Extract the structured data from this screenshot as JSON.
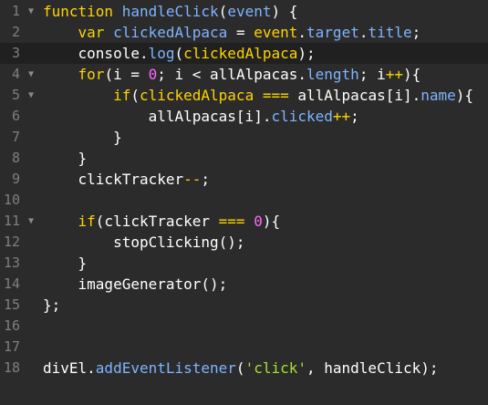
{
  "editor": {
    "lines": [
      {
        "num": "1",
        "fold": true,
        "tokens": [
          {
            "t": "function",
            "c": "kw"
          },
          {
            "t": " ",
            "c": "plain"
          },
          {
            "t": "handleClick",
            "c": "fn"
          },
          {
            "t": "(",
            "c": "plain"
          },
          {
            "t": "event",
            "c": "fn"
          },
          {
            "t": ") {",
            "c": "plain"
          }
        ]
      },
      {
        "num": "2",
        "fold": false,
        "tokens": [
          {
            "t": "    ",
            "c": "plain"
          },
          {
            "t": "var",
            "c": "kw"
          },
          {
            "t": " ",
            "c": "plain"
          },
          {
            "t": "clickedAlpaca",
            "c": "fn"
          },
          {
            "t": " = ",
            "c": "plain"
          },
          {
            "t": "event",
            "c": "kw"
          },
          {
            "t": ".",
            "c": "plain"
          },
          {
            "t": "target",
            "c": "prop"
          },
          {
            "t": ".",
            "c": "plain"
          },
          {
            "t": "title",
            "c": "prop"
          },
          {
            "t": ";",
            "c": "plain"
          }
        ]
      },
      {
        "num": "3",
        "fold": false,
        "active": true,
        "tokens": [
          {
            "t": "    console.",
            "c": "plain"
          },
          {
            "t": "log",
            "c": "prop"
          },
          {
            "t": "(",
            "c": "plain"
          },
          {
            "t": "clickedAlpaca",
            "c": "kw"
          },
          {
            "t": ");",
            "c": "plain"
          }
        ]
      },
      {
        "num": "4",
        "fold": true,
        "tokens": [
          {
            "t": "    ",
            "c": "plain"
          },
          {
            "t": "for",
            "c": "kw"
          },
          {
            "t": "(i = ",
            "c": "plain"
          },
          {
            "t": "0",
            "c": "num"
          },
          {
            "t": "; i < allAlpacas.",
            "c": "plain"
          },
          {
            "t": "length",
            "c": "prop"
          },
          {
            "t": "; i",
            "c": "plain"
          },
          {
            "t": "++",
            "c": "kw"
          },
          {
            "t": "){",
            "c": "plain"
          }
        ]
      },
      {
        "num": "5",
        "fold": true,
        "tokens": [
          {
            "t": "        ",
            "c": "plain"
          },
          {
            "t": "if",
            "c": "kw"
          },
          {
            "t": "(",
            "c": "plain"
          },
          {
            "t": "clickedAlpaca",
            "c": "kw"
          },
          {
            "t": " ",
            "c": "plain"
          },
          {
            "t": "===",
            "c": "kw"
          },
          {
            "t": " allAlpacas[i].",
            "c": "plain"
          },
          {
            "t": "name",
            "c": "prop"
          },
          {
            "t": "){",
            "c": "plain"
          }
        ]
      },
      {
        "num": "6",
        "fold": false,
        "tokens": [
          {
            "t": "            allAlpacas[i].",
            "c": "plain"
          },
          {
            "t": "clicked",
            "c": "prop"
          },
          {
            "t": "++",
            "c": "kw"
          },
          {
            "t": ";",
            "c": "plain"
          }
        ]
      },
      {
        "num": "7",
        "fold": false,
        "tokens": [
          {
            "t": "        }",
            "c": "plain"
          }
        ]
      },
      {
        "num": "8",
        "fold": false,
        "tokens": [
          {
            "t": "    }",
            "c": "plain"
          }
        ]
      },
      {
        "num": "9",
        "fold": false,
        "tokens": [
          {
            "t": "    clickTracker",
            "c": "plain"
          },
          {
            "t": "--",
            "c": "kw"
          },
          {
            "t": ";",
            "c": "plain"
          }
        ]
      },
      {
        "num": "10",
        "fold": false,
        "tokens": []
      },
      {
        "num": "11",
        "fold": true,
        "tokens": [
          {
            "t": "    ",
            "c": "plain"
          },
          {
            "t": "if",
            "c": "kw"
          },
          {
            "t": "(clickTracker ",
            "c": "plain"
          },
          {
            "t": "===",
            "c": "kw"
          },
          {
            "t": " ",
            "c": "plain"
          },
          {
            "t": "0",
            "c": "num"
          },
          {
            "t": "){",
            "c": "plain"
          }
        ]
      },
      {
        "num": "12",
        "fold": false,
        "tokens": [
          {
            "t": "        stopClicking();",
            "c": "plain"
          }
        ]
      },
      {
        "num": "13",
        "fold": false,
        "tokens": [
          {
            "t": "    }",
            "c": "plain"
          }
        ]
      },
      {
        "num": "14",
        "fold": false,
        "tokens": [
          {
            "t": "    imageGenerator();",
            "c": "plain"
          }
        ]
      },
      {
        "num": "15",
        "fold": false,
        "tokens": [
          {
            "t": "};",
            "c": "plain"
          }
        ]
      },
      {
        "num": "16",
        "fold": false,
        "tokens": []
      },
      {
        "num": "17",
        "fold": false,
        "tokens": []
      },
      {
        "num": "18",
        "fold": false,
        "tokens": [
          {
            "t": "divEl.",
            "c": "plain"
          },
          {
            "t": "addEventListener",
            "c": "prop"
          },
          {
            "t": "(",
            "c": "plain"
          },
          {
            "t": "'click'",
            "c": "str"
          },
          {
            "t": ", handleClick);",
            "c": "plain"
          }
        ]
      }
    ]
  },
  "colors": {
    "background": "#2b2b2b",
    "active_line": "#202020",
    "keyword": "#ffd400",
    "function": "#7fb4ff",
    "number": "#ff66ff",
    "string": "#a6e22e",
    "gutter_text": "#7f7f7f"
  },
  "icons": {
    "fold": "chevron-down-icon"
  }
}
